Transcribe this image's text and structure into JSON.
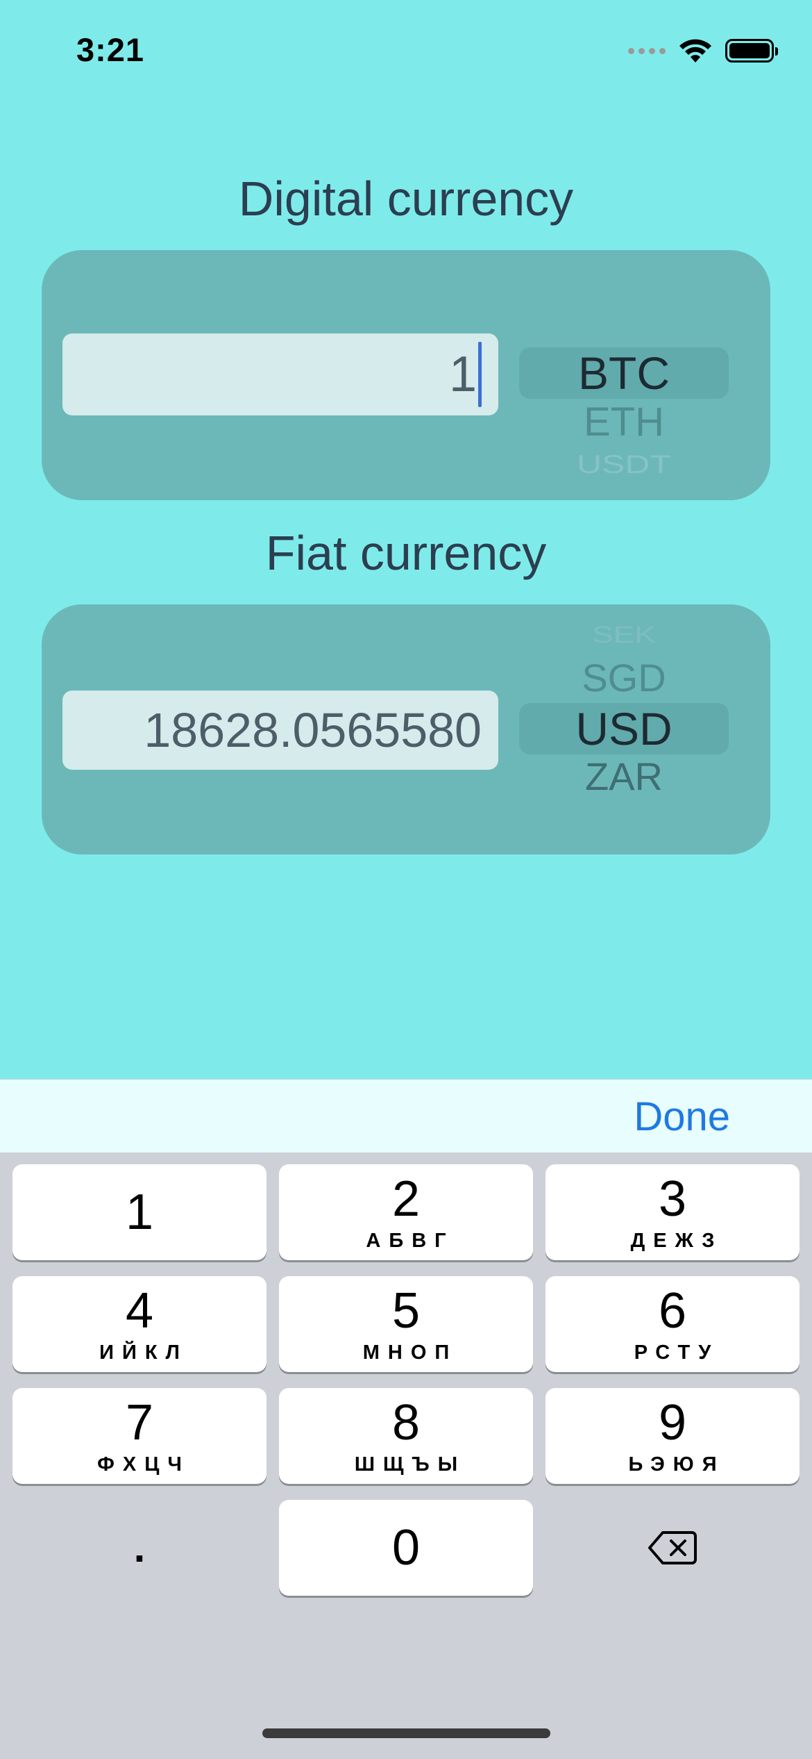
{
  "status_bar": {
    "time": "3:21"
  },
  "digital": {
    "title": "Digital currency",
    "amount": "1",
    "picker": [
      "BTC",
      "ETH",
      "USDT"
    ]
  },
  "fiat": {
    "title": "Fiat currency",
    "amount": "18628.0565580",
    "picker": [
      "SEK",
      "SGD",
      "USD",
      "ZAR"
    ]
  },
  "keyboard": {
    "done_label": "Done",
    "keys": [
      {
        "digit": "1",
        "letters": ""
      },
      {
        "digit": "2",
        "letters": "АБВГ"
      },
      {
        "digit": "3",
        "letters": "ДЕЖЗ"
      },
      {
        "digit": "4",
        "letters": "ИЙКЛ"
      },
      {
        "digit": "5",
        "letters": "МНОП"
      },
      {
        "digit": "6",
        "letters": "РСТУ"
      },
      {
        "digit": "7",
        "letters": "ФХЦЧ"
      },
      {
        "digit": "8",
        "letters": "ШЩЪЫ"
      },
      {
        "digit": "9",
        "letters": "ЬЭЮЯ"
      }
    ],
    "decimal": ".",
    "zero": "0",
    "delete_icon": "delete-backward-icon"
  }
}
